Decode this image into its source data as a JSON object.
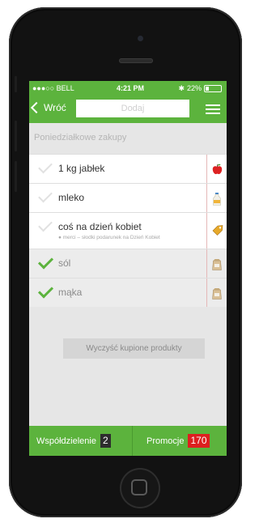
{
  "status": {
    "carrier": "●●●○○ BELL",
    "time": "4:21 PM",
    "battery": "22%",
    "battery_level": 0.22
  },
  "nav": {
    "back_label": "Wróć",
    "add_placeholder": "Dodaj"
  },
  "list": {
    "title": "Poniedziałkowe zakupy",
    "items": [
      {
        "name": "1 kg jabłek",
        "bought": false,
        "icon": "apple-icon"
      },
      {
        "name": "mleko",
        "bought": false,
        "icon": "milk-bottle-icon"
      },
      {
        "name": "coś na dzień kobiet",
        "note": "● merci – słodki podarunek na Dzień Kobiet",
        "bought": false,
        "icon": "price-tag-icon"
      },
      {
        "name": "sól",
        "bought": true,
        "icon": "paper-bag-icon"
      },
      {
        "name": "mąka",
        "bought": true,
        "icon": "paper-bag-icon"
      }
    ]
  },
  "clear_button": "Wyczyść kupione produkty",
  "bottom": {
    "share_label": "Współdzielenie",
    "share_count": "2",
    "promo_label": "Promocje",
    "promo_count": "170"
  },
  "colors": {
    "accent": "#5cb33d",
    "badge_red": "#dd1f1f",
    "badge_dark": "#2d2d2d"
  }
}
